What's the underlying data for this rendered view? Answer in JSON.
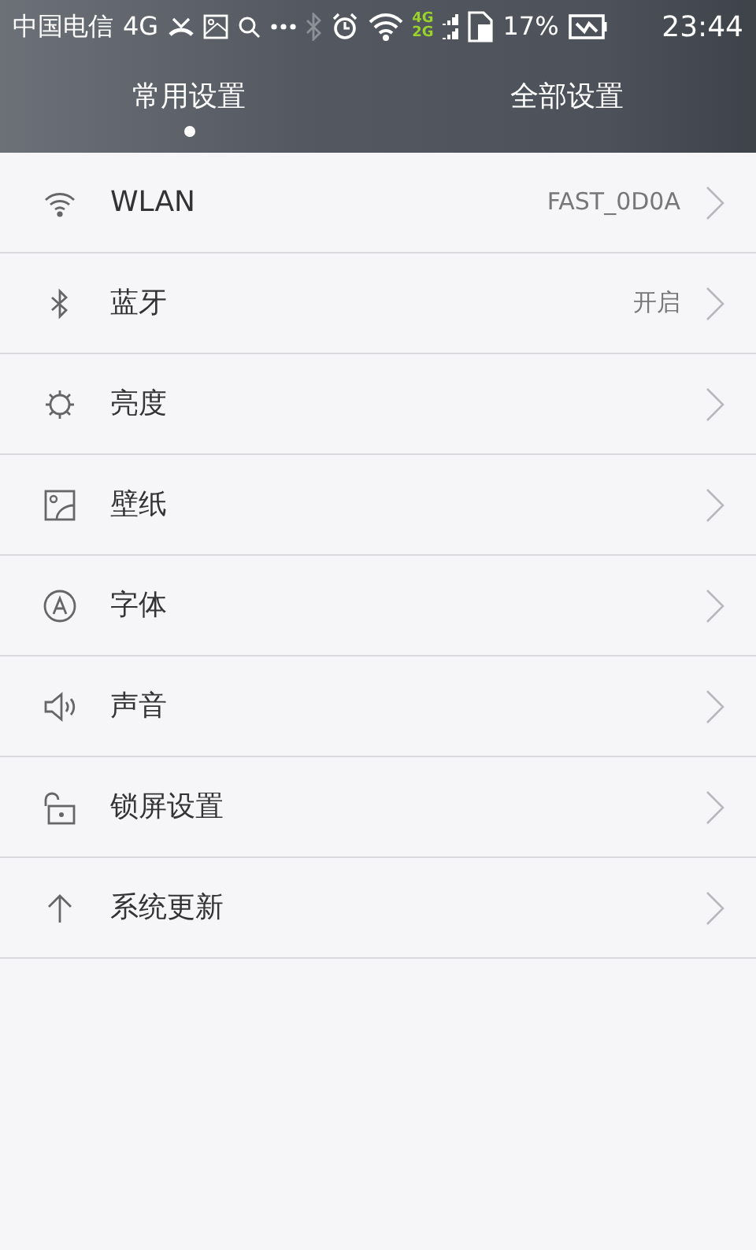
{
  "status_bar": {
    "carrier": "中国电信",
    "network": "4G",
    "sim_1": "4G",
    "sim_2": "2G",
    "battery": "17%",
    "time": "23:44"
  },
  "tabs": [
    {
      "label": "常用设置",
      "selected": true
    },
    {
      "label": "全部设置",
      "selected": false
    }
  ],
  "settings": [
    {
      "label": "WLAN",
      "value": "FAST_0D0A"
    },
    {
      "label": "蓝牙",
      "value": "开启"
    },
    {
      "label": "亮度"
    },
    {
      "label": "壁纸"
    },
    {
      "label": "字体"
    },
    {
      "label": "声音"
    },
    {
      "label": "锁屏设置"
    },
    {
      "label": "系统更新"
    }
  ]
}
